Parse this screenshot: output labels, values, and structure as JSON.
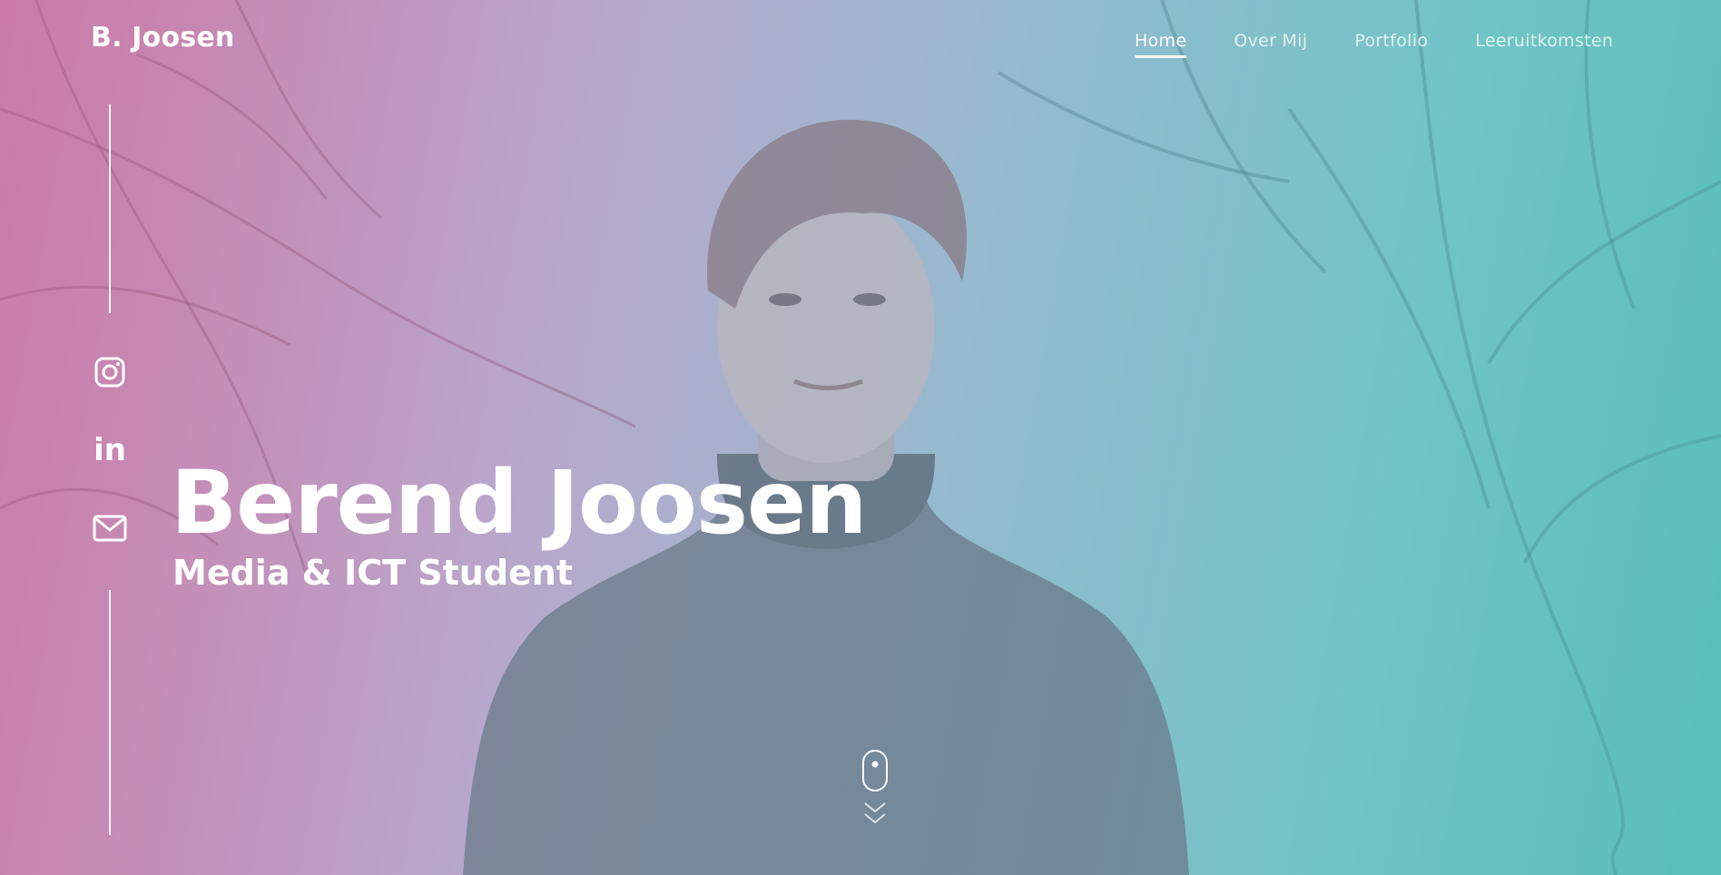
{
  "brand": {
    "logo_text": "B. Joosen"
  },
  "nav": {
    "items": [
      {
        "label": "Home",
        "active": true
      },
      {
        "label": "Over Mij",
        "active": false
      },
      {
        "label": "Portfolio",
        "active": false
      },
      {
        "label": "Leeruitkomsten",
        "active": false
      }
    ]
  },
  "social": {
    "icons": [
      "instagram-icon",
      "linkedin-icon",
      "mail-icon"
    ],
    "linkedin_text": "in"
  },
  "hero": {
    "title": "Berend Joosen",
    "subtitle": "Media & ICT Student"
  },
  "scroll": {
    "icons": [
      "mouse-icon",
      "chevron-down-icon"
    ]
  },
  "colors": {
    "text": "#ffffff",
    "gradient_left": "#c67ba5",
    "gradient_right": "#5fb8b3"
  }
}
